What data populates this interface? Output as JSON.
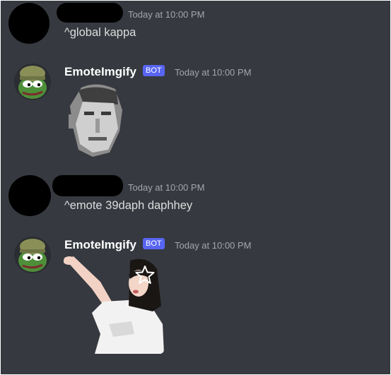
{
  "messages": [
    {
      "author": "",
      "timestamp": "Today at 10:00 PM",
      "text": "^global kappa"
    },
    {
      "author": "EmoteImgify",
      "badge": "BOT",
      "timestamp": "Today at 10:00 PM",
      "attachment": "kappa-emote"
    },
    {
      "author": "",
      "timestamp": "Today at 10:00 PM",
      "text": "^emote 39daph daphhey"
    },
    {
      "author": "EmoteImgify",
      "badge": "BOT",
      "timestamp": "Today at 10:00 PM",
      "attachment": "daphhey-emote"
    }
  ],
  "icons": {
    "star": "star-icon",
    "bot_avatar": "pepe-soldier-avatar"
  },
  "colors": {
    "background": "#36393f",
    "bot_badge": "#5865f2",
    "timestamp": "#a3a6aa",
    "username": "#ffffff",
    "message_text": "#dcddde"
  }
}
